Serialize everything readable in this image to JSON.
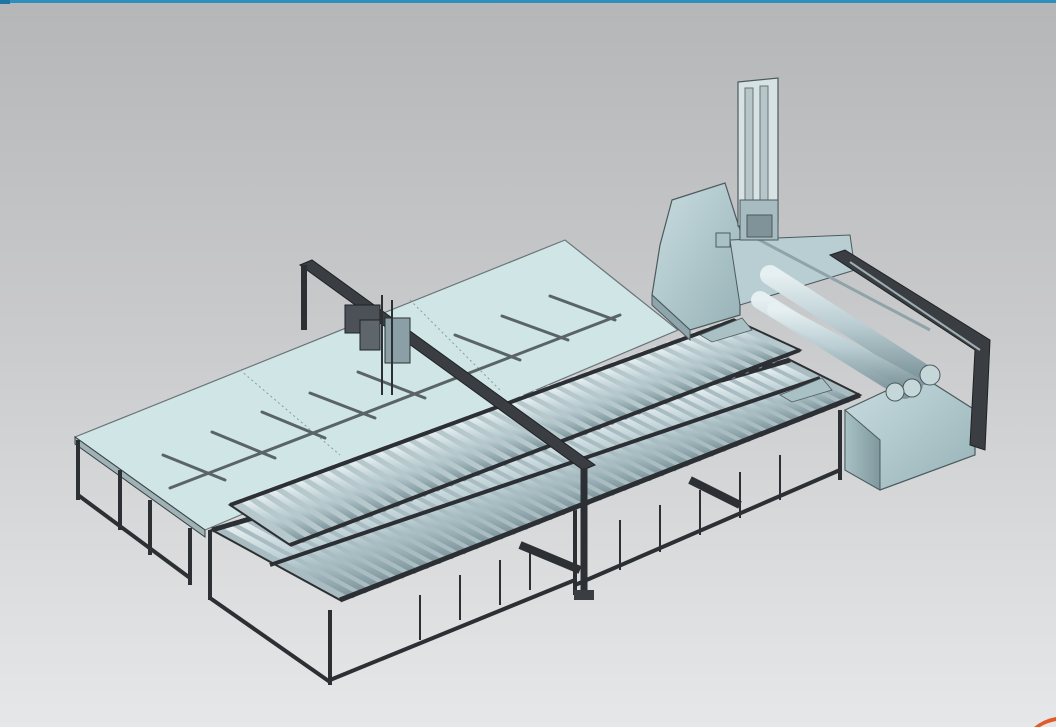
{
  "viewport": {
    "background_top": "#b5b6b8",
    "background_bottom": "#e6e7e9",
    "accent_color": "#2e8fbd"
  },
  "model": {
    "glass_color": "#cfe5e6",
    "frame_color": "#2c2f33",
    "roller_color": "#b9cdd2",
    "machine_color": "#b4cdd1",
    "corner_mark_color": "#e05a2b"
  }
}
